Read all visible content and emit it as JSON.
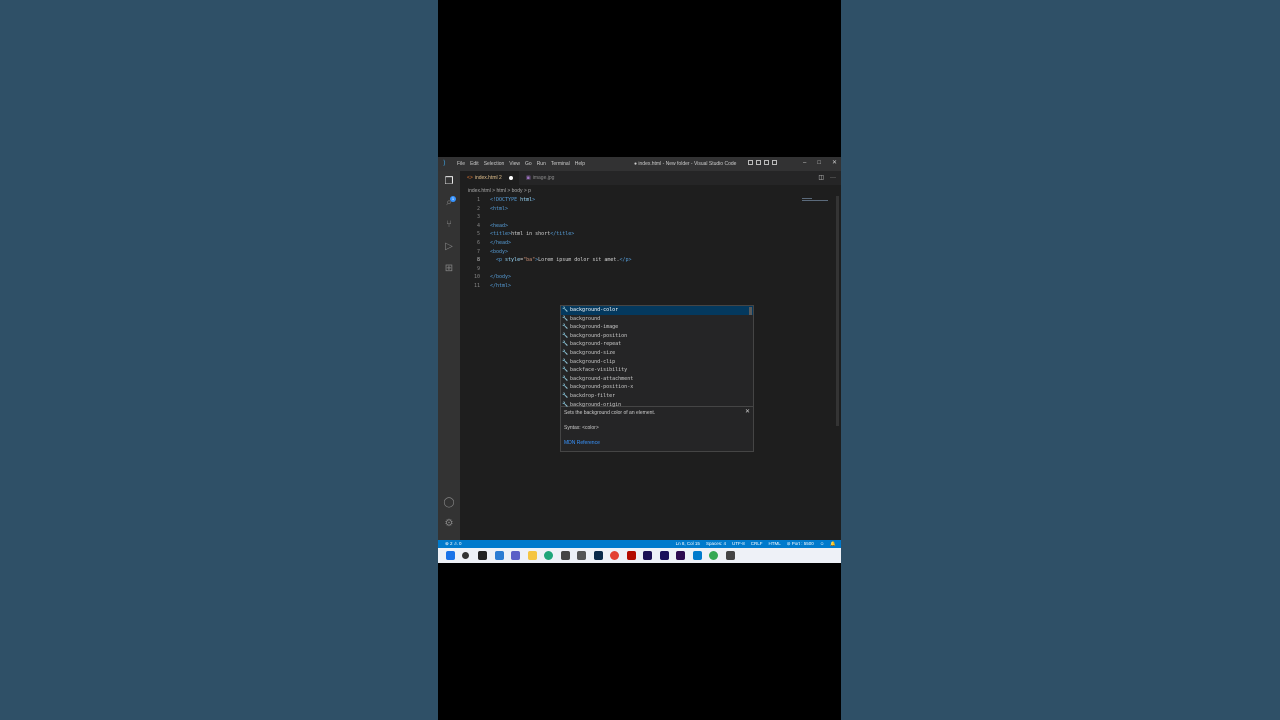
{
  "window": {
    "title": "● index.html - New folder - Visual Studio Code",
    "menu": [
      "File",
      "Edit",
      "Selection",
      "View",
      "Go",
      "Run",
      "Terminal",
      "Help"
    ]
  },
  "tabs": [
    {
      "label": "index.html 2",
      "modified": true
    },
    {
      "label": "image.jpg",
      "modified": false
    }
  ],
  "breadcrumb": "index.html > html > body > p",
  "code_lines": [
    {
      "n": "1"
    },
    {
      "n": "2"
    },
    {
      "n": "3"
    },
    {
      "n": "4"
    },
    {
      "n": "5"
    },
    {
      "n": "6"
    },
    {
      "n": "7"
    },
    {
      "n": "8"
    },
    {
      "n": "9"
    },
    {
      "n": "10"
    },
    {
      "n": "11"
    }
  ],
  "code": {
    "l1_a": "<!DOCTYPE ",
    "l1_b": "html",
    "l1_c": ">",
    "l2": "<html>",
    "l4": "<head>",
    "l5_open": "<title>",
    "l5_text": "html in short",
    "l5_close": "</title>",
    "l6": "</head>",
    "l7": "<body>",
    "l8_open": "<p ",
    "l8_attr": "style",
    "l8_eq": "=",
    "l8_val": "\"ba\"",
    "l8_gt": ">",
    "l8_text": "Lorem ipsum dolor sit amet.",
    "l8_close": "</p>",
    "l10": "</body>",
    "l11": "</html>"
  },
  "suggestions": [
    "background-color",
    "background",
    "background-image",
    "background-position",
    "background-repeat",
    "background-size",
    "background-clip",
    "backface-visibility",
    "background-attachment",
    "background-position-x",
    "backdrop-filter",
    "background-origin"
  ],
  "suggest_docs": {
    "description": "Sets the background color of an element.",
    "syntax": "Syntax: <color>",
    "link": "MDN Reference"
  },
  "status": {
    "problems": "⊗ 2 ⚠ 0",
    "position": "Ln 8, Col 15",
    "spaces": "Spaces: 4",
    "encoding": "UTF-8",
    "eol": "CRLF",
    "language": "HTML",
    "port": "⊘ Port : 5500"
  },
  "colors": {
    "accent": "#007acc",
    "editor_bg": "#1e1e1e",
    "page_bg": "#2f5067"
  },
  "taskbar_icons": [
    "windows-start-icon",
    "search-icon",
    "terminal-icon",
    "file-explorer-icon",
    "teams-chat-icon",
    "folder-icon",
    "edge-icon",
    "store-icon",
    "app-icon",
    "photoshop-icon",
    "chrome-icon",
    "acrobat-icon",
    "media-encoder-icon",
    "after-effects-icon",
    "premiere-icon",
    "vscode-icon",
    "chrome-icon-2",
    "todo-icon"
  ]
}
